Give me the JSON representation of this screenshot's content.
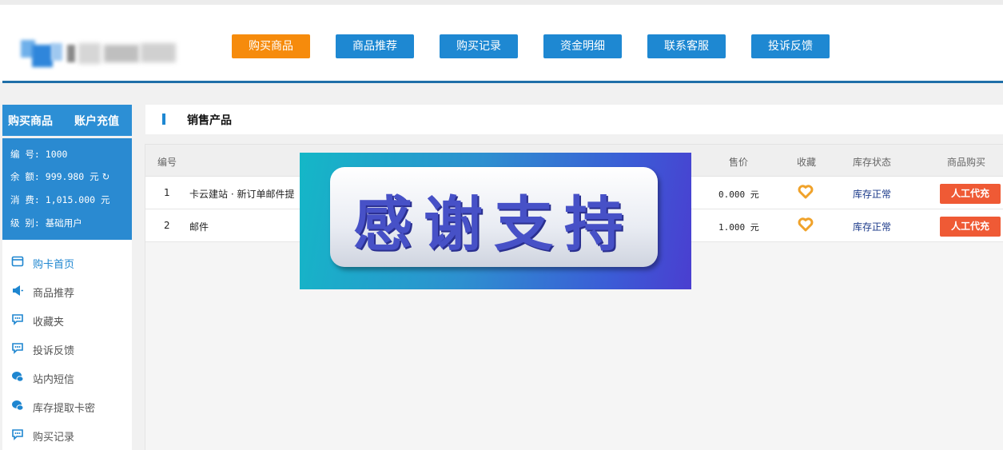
{
  "header": {
    "nav": [
      {
        "label": "购买商品",
        "active": true
      },
      {
        "label": "商品推荐",
        "active": false
      },
      {
        "label": "购买记录",
        "active": false
      },
      {
        "label": "资金明细",
        "active": false
      },
      {
        "label": "联系客服",
        "active": false
      },
      {
        "label": "投诉反馈",
        "active": false
      }
    ]
  },
  "sidebar": {
    "tabs": [
      "购买商品",
      "账户充值"
    ],
    "account": {
      "id": "编 号: 1000",
      "balance": "余 额: 999.980 元",
      "spent": "消 费: 1,015.000 元",
      "level": "级 别: 基础用户"
    },
    "menu": [
      {
        "label": "购卡首页",
        "icon": "card-icon"
      },
      {
        "label": "商品推荐",
        "icon": "megaphone-icon"
      },
      {
        "label": "收藏夹",
        "icon": "chat-icon"
      },
      {
        "label": "投诉反馈",
        "icon": "chat-icon"
      },
      {
        "label": "站内短信",
        "icon": "message-icon"
      },
      {
        "label": "库存提取卡密",
        "icon": "message-icon"
      },
      {
        "label": "购买记录",
        "icon": "chat-icon"
      }
    ]
  },
  "main": {
    "title": "销售产品",
    "columns": [
      "编号",
      "售价",
      "收藏",
      "库存状态",
      "商品购买"
    ],
    "rows": [
      {
        "no": "1",
        "name": "卡云建站 · 新订单邮件提",
        "price": "0.000 元",
        "stock": "库存正常",
        "buy": "人工代充"
      },
      {
        "no": "2",
        "name": "邮件",
        "price": "1.000 元",
        "stock": "库存正常",
        "buy": "人工代充"
      }
    ]
  },
  "overlay": {
    "text": "感谢支持"
  },
  "colors": {
    "accent": "#1e88d2",
    "active_nav": "#f68b0c",
    "buy_button": "#ef5a35",
    "heart": "#f0a22a"
  }
}
